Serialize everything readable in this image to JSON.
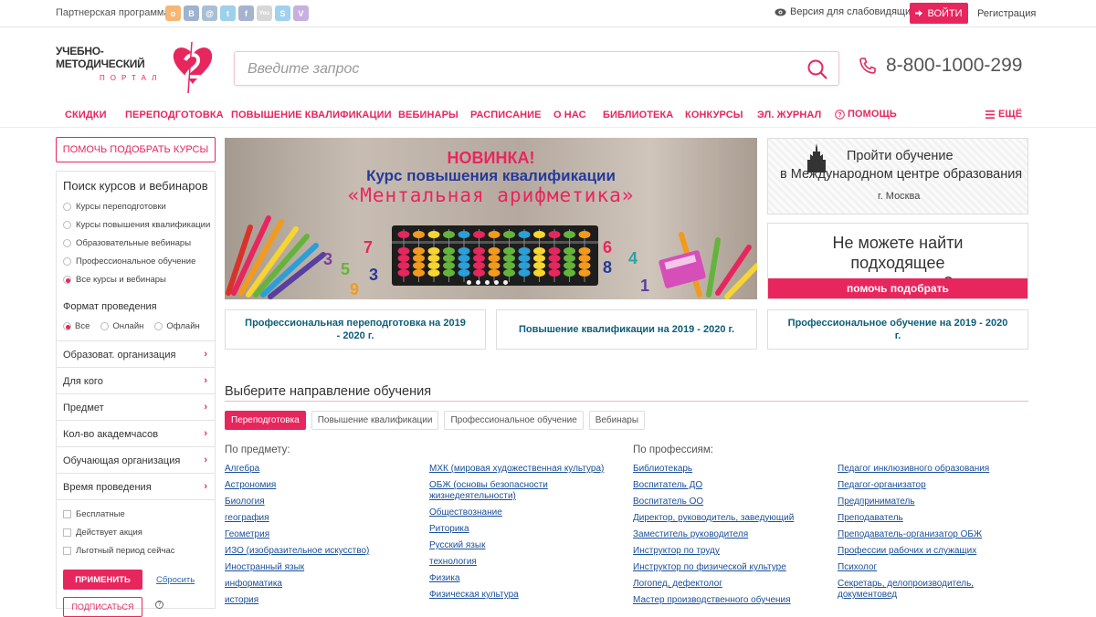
{
  "topbar": {
    "partner": "Партнерская программа",
    "socials": [
      {
        "icon": "odnoklassniki-icon",
        "glyph": "о",
        "color": "#f5b774"
      },
      {
        "icon": "vk-icon",
        "glyph": "В",
        "color": "#9db3cf"
      },
      {
        "icon": "mail-icon",
        "glyph": "@",
        "color": "#a9bfd6"
      },
      {
        "icon": "twitter-icon",
        "glyph": "t",
        "color": "#9dd0ea"
      },
      {
        "icon": "facebook-icon",
        "glyph": "f",
        "color": "#a5b3cf"
      },
      {
        "icon": "youtube-icon",
        "glyph": "You",
        "color": "#d7d7d7"
      },
      {
        "icon": "skype-icon",
        "glyph": "S",
        "color": "#9fd2ee"
      },
      {
        "icon": "viber-icon",
        "glyph": "V",
        "color": "#c6b0df"
      }
    ],
    "vision": "Версия для слабовидящих",
    "login": "ВОЙТИ",
    "register": "Регистрация"
  },
  "logo": {
    "line1": "УЧЕБНО-",
    "line2": "МЕТОДИЧЕСКИЙ",
    "line3": "ПОРТАЛ"
  },
  "search": {
    "placeholder": "Введите запрос"
  },
  "phone": "8-800-1000-299",
  "nav": {
    "items": [
      "СКИДКИ",
      "ПЕРЕПОДГОТОВКА",
      "ПОВЫШЕНИЕ КВАЛИФИКАЦИИ",
      "ВЕБИНАРЫ",
      "РАСПИСАНИЕ",
      "О НАС",
      "БИБЛИОТЕКА",
      "КОНКУРСЫ",
      "ЭЛ. ЖУРНАЛ",
      "ПОМОЩЬ"
    ],
    "more": "ЕЩЁ"
  },
  "sidebar": {
    "help_button": "ПОМОЧЬ ПОДОБРАТЬ КУРСЫ",
    "search_title": "Поиск курсов и вебинаров",
    "types": [
      "Курсы переподготовки",
      "Курсы повышения квалификации",
      "Образовательные вебинары",
      "Профессиональное обучение",
      "Все курсы и вебинары"
    ],
    "type_selected": "Все курсы и вебинары",
    "format_title": "Формат проведения",
    "formats": [
      "Все",
      "Онлайн",
      "Офлайн"
    ],
    "format_selected": "Все",
    "accordions": [
      "Образоват. организация",
      "Для кого",
      "Предмет",
      "Кол-во академчасов",
      "Обучающая организация",
      "Время проведения"
    ],
    "checkboxes": [
      "Бесплатные",
      "Действует акция",
      "Льготный период сейчас"
    ],
    "apply": "ПРИМЕНИТЬ",
    "reset": "Сбросить",
    "subscribe": "ПОДПИСАТЬСЯ"
  },
  "banner": {
    "line1": "НОВИНКА!",
    "line2": "Курс повышения квалификации",
    "line3": "«Ментальная арифметика»",
    "numbers_left": [
      "3",
      "7",
      "5",
      "3",
      "9"
    ],
    "numbers_right": [
      "6",
      "4",
      "8",
      "1"
    ]
  },
  "promo1": {
    "line1": "Пройти обучение",
    "line2": "в Международном центре образования",
    "line3": "г. Москва"
  },
  "promo2": {
    "text": "Не можете найти подходящее мероприятие?",
    "button": "помочь подобрать"
  },
  "tiles": [
    "Профессиональная переподготовка на 2019 - 2020 г.",
    "Повышение квалификации на 2019 - 2020 г.",
    "Профессиональное обучение на 2019 - 2020 г."
  ],
  "directions": {
    "title": "Выберите направление обучения",
    "tabs": [
      "Переподготовка",
      "Повышение квалификации",
      "Профессиональное обучение",
      "Вебинары"
    ],
    "active_tab": "Переподготовка",
    "by_subject": "По предмету:",
    "by_profession": "По профессиям:",
    "subjects_col1": [
      "Алгебра",
      "Астрономия",
      "Биология",
      "география",
      "Геометрия",
      "ИЗО (изобразительное искусство)",
      "Иностранный язык",
      "информатика",
      "история"
    ],
    "subjects_col2": [
      "МХК (мировая художественная культура)",
      "ОБЖ (основы безопасности жизнедеятельности)",
      "Обществознание",
      "Риторика",
      "Русский язык",
      "технология",
      "Физика",
      "Физическая культура"
    ],
    "professions_col1": [
      "Библиотекарь",
      "Воспитатель ДО",
      "Воспитатель ОО",
      "Директор, руководитель, заведующий",
      "Заместитель руководителя",
      "Инструктор по труду",
      "Инструктор по физической культуре",
      "Логопед, дефектолог",
      "Мастер производственного обучения"
    ],
    "professions_col2": [
      "Педагог инклюзивного образования",
      "Педагог-организатор",
      "Предприниматель",
      "Преподаватель",
      "Преподаватель-организатор ОБЖ",
      "Профессии рабочих и служащих",
      "Психолог",
      "Секретарь, делопроизводитель, документовед"
    ]
  },
  "colors": {
    "accent": "#e8265e",
    "link": "#1a4f9a",
    "tile_text": "#0d5d7a"
  }
}
